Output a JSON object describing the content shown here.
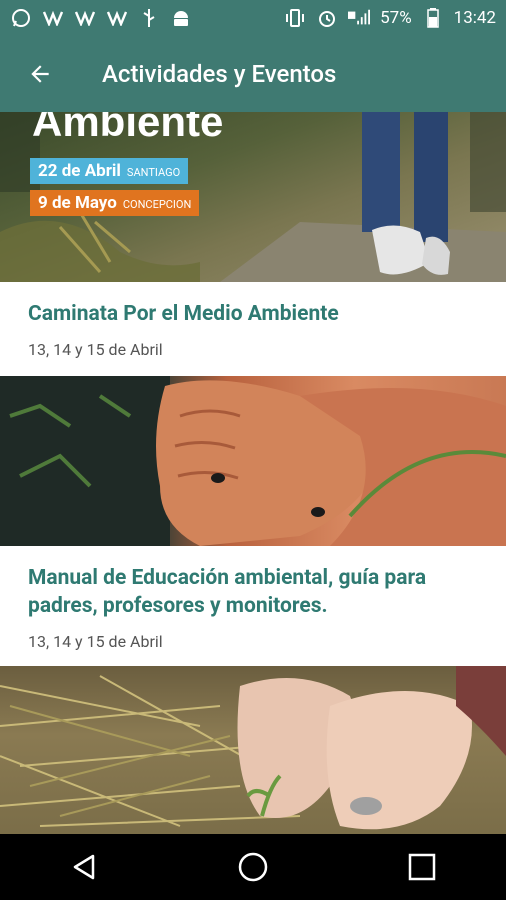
{
  "status_bar": {
    "battery": "57%",
    "time": "13:42"
  },
  "app_bar": {
    "title": "Actividades y Eventos"
  },
  "cards": [
    {
      "banner_title": "Ambiente",
      "banner_tags": [
        {
          "date": "22 de Abril",
          "place": "SANTIAGO"
        },
        {
          "date": "9 de Mayo",
          "place": "CONCEPCION"
        }
      ],
      "title": "Caminata Por el Medio Ambiente",
      "date": "13, 14 y 15 de Abril"
    },
    {
      "title": "Manual de Educación ambiental, guía para padres, profesores y monitores.",
      "date": "13, 14 y 15 de Abril"
    },
    {
      "title": "",
      "date": ""
    }
  ],
  "colors": {
    "primary": "#3f7a72",
    "title_text": "#2f7a72",
    "tag_blue": "#4fb3d9",
    "tag_orange": "#e0741f"
  }
}
